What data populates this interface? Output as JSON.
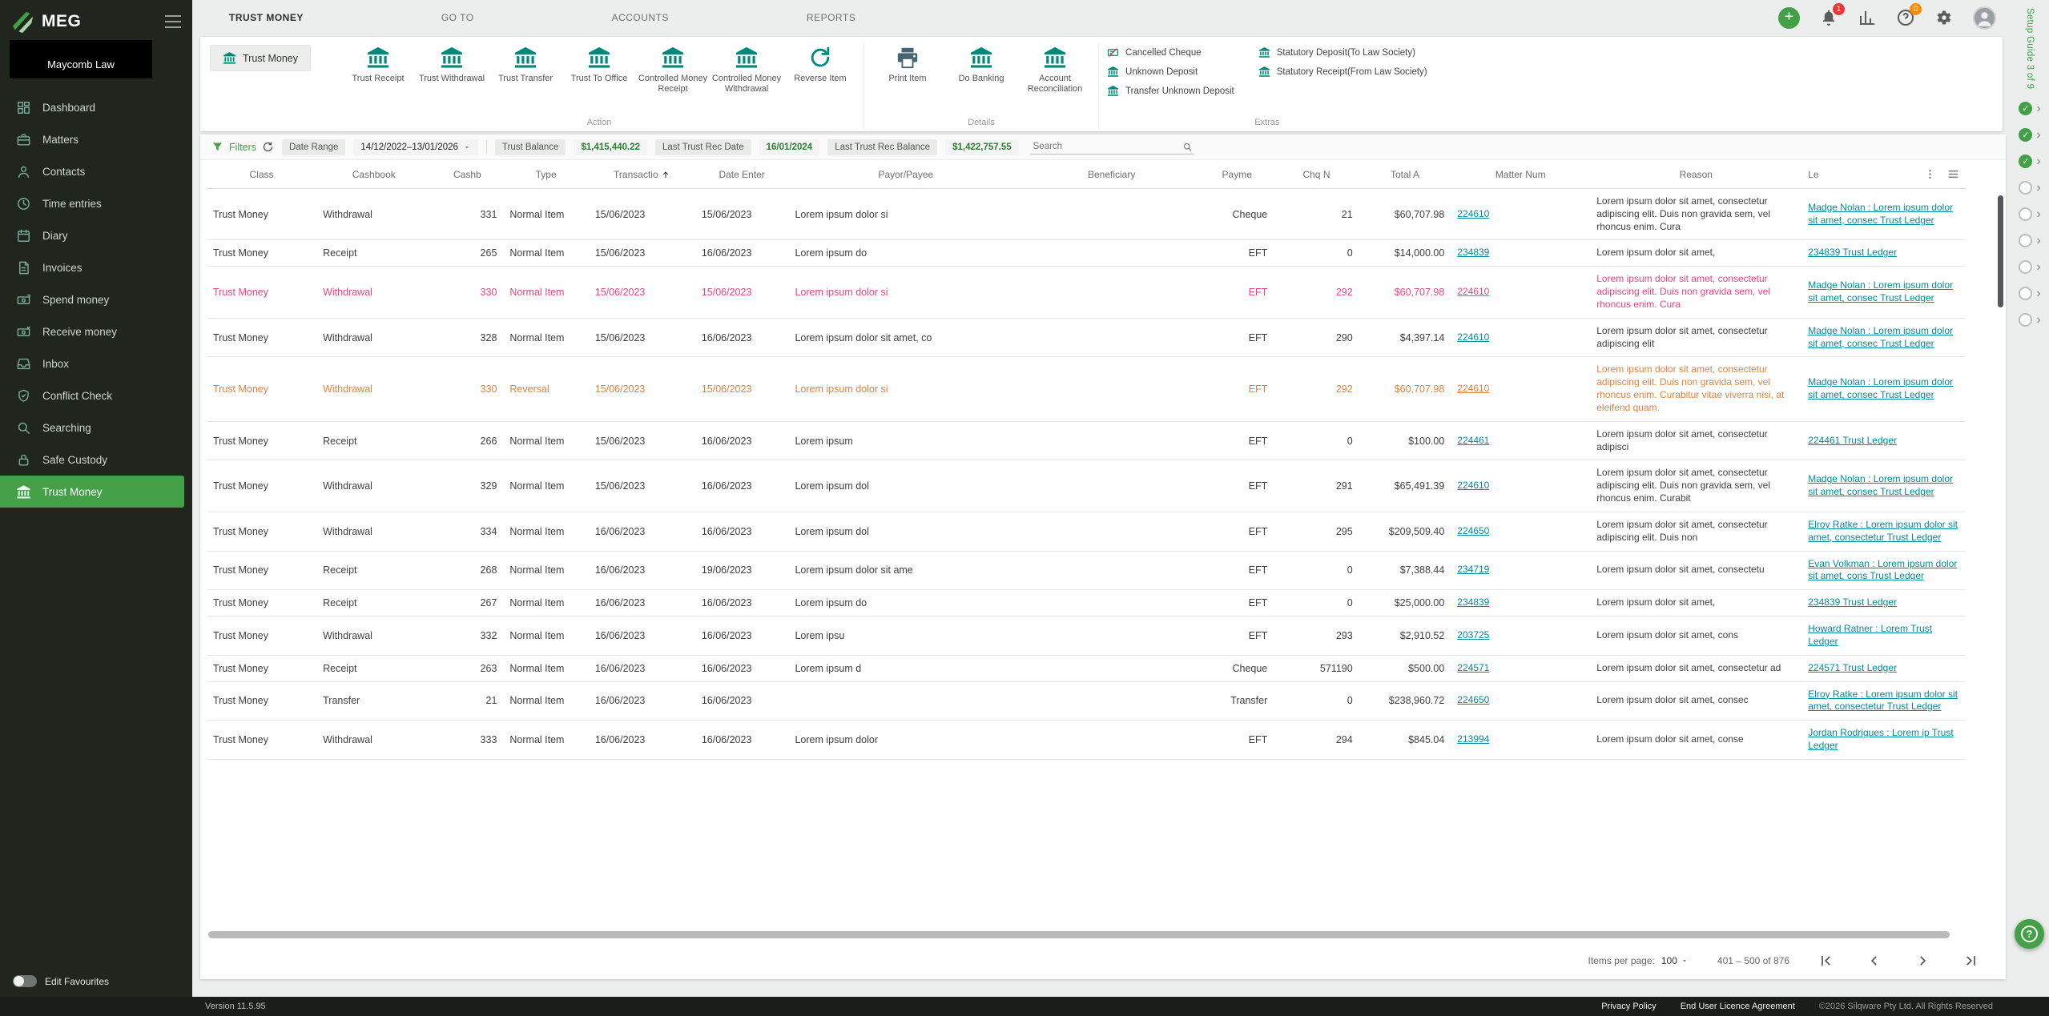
{
  "brand": {
    "logo_text": "MEG",
    "firm_name": "Maycomb Law",
    "version": "Version 11.5.95"
  },
  "topnav": {
    "tabs": [
      {
        "label": "TRUST MONEY",
        "active": true
      },
      {
        "label": "GO TO",
        "active": false
      },
      {
        "label": "ACCOUNTS",
        "active": false
      },
      {
        "label": "REPORTS",
        "active": false
      }
    ],
    "notifications_badge": "1",
    "help_badge": "0"
  },
  "sidebar": {
    "items": [
      {
        "label": "Dashboard",
        "icon": "dashboard-icon",
        "active": false
      },
      {
        "label": "Matters",
        "icon": "briefcase-icon",
        "active": false
      },
      {
        "label": "Contacts",
        "icon": "contacts-icon",
        "active": false
      },
      {
        "label": "Time entries",
        "icon": "clock-icon",
        "active": false
      },
      {
        "label": "Diary",
        "icon": "calendar-icon",
        "active": false
      },
      {
        "label": "Invoices",
        "icon": "invoice-icon",
        "active": false
      },
      {
        "label": "Spend money",
        "icon": "spend-money-icon",
        "active": false
      },
      {
        "label": "Receive money",
        "icon": "receive-money-icon",
        "active": false
      },
      {
        "label": "Inbox",
        "icon": "inbox-icon",
        "active": false
      },
      {
        "label": "Conflict Check",
        "icon": "shield-icon",
        "active": false
      },
      {
        "label": "Searching",
        "icon": "search-icon",
        "active": false
      },
      {
        "label": "Safe Custody",
        "icon": "lock-icon",
        "active": false
      },
      {
        "label": "Trust Money",
        "icon": "bank-icon",
        "active": true
      }
    ],
    "edit_favourites_label": "Edit Favourites"
  },
  "toolbar": {
    "tab_label": "Trust Money",
    "groups": [
      {
        "label": "Action",
        "items": [
          {
            "label": "Trust Receipt",
            "icon": "bank-icon"
          },
          {
            "label": "Trust Withdrawal",
            "icon": "bank-icon"
          },
          {
            "label": "Trust Transfer",
            "icon": "bank-icon"
          },
          {
            "label": "Trust To Office",
            "icon": "bank-icon"
          },
          {
            "label": "Controlled Money Receipt",
            "icon": "bank-icon"
          },
          {
            "label": "Controlled Money Withdrawal",
            "icon": "bank-icon"
          },
          {
            "label": "Reverse Item",
            "icon": "reverse-icon"
          }
        ]
      },
      {
        "label": "Details",
        "items": [
          {
            "label": "Print Item",
            "icon": "printer-icon"
          },
          {
            "label": "Do Banking",
            "icon": "bank-icon"
          },
          {
            "label": "Account Reconciliation",
            "icon": "bank-icon"
          }
        ]
      }
    ],
    "extras": {
      "label": "Extras",
      "left": [
        {
          "label": "Cancelled Cheque",
          "icon": "cancelled-cheque-icon"
        },
        {
          "label": "Unknown Deposit",
          "icon": "bank-small-icon"
        },
        {
          "label": "Transfer Unknown Deposit",
          "icon": "bank-small-icon"
        }
      ],
      "right": [
        {
          "label": "Statutory Deposit(To Law Society)",
          "icon": "bank-small-icon"
        },
        {
          "label": "Statutory Receipt(From Law Society)",
          "icon": "bank-small-icon"
        }
      ]
    }
  },
  "filters": {
    "label": "Filters",
    "date_range_label": "Date Range",
    "date_range_value": "14/12/2022–13/01/2026",
    "trust_balance_label": "Trust Balance",
    "trust_balance_value": "$1,415,440.22",
    "last_rec_date_label": "Last Trust Rec Date",
    "last_rec_date_value": "16/01/2024",
    "last_rec_balance_label": "Last Trust Rec Balance",
    "last_rec_balance_value": "$1,422,757.55",
    "search_placeholder": "Search"
  },
  "table": {
    "columns": [
      {
        "label": "Class"
      },
      {
        "label": "Cashbook"
      },
      {
        "label": "Cashb",
        "align": "right"
      },
      {
        "label": "Type"
      },
      {
        "label": "Transactio",
        "sort": "asc"
      },
      {
        "label": "Date Enter"
      },
      {
        "label": "Payor/Payee"
      },
      {
        "label": "Beneficiary"
      },
      {
        "label": "Payme",
        "align": "right"
      },
      {
        "label": "Chq N",
        "align": "right"
      },
      {
        "label": "Total A",
        "align": "right"
      },
      {
        "label": "Matter Num"
      },
      {
        "label": "Reason"
      },
      {
        "label": "Le"
      }
    ],
    "rows": [
      {
        "class": "Trust Money",
        "cashbook": "Withdrawal",
        "number": "331",
        "type": "Normal Item",
        "trans_date": "15/06/2023",
        "entered_date": "15/06/2023",
        "payor": "Lorem ipsum dolor si",
        "beneficiary": "",
        "payment": "Cheque",
        "chq": "21",
        "total": "$60,707.98",
        "matter": "224610",
        "reason": "Lorem ipsum dolor sit amet, consectetur adipiscing elit. Duis non gravida sem, vel rhoncus enim. Cura",
        "ledger": "Madge Nolan : Lorem ipsum dolor sit amet, consec Trust Ledger",
        "state": "normal"
      },
      {
        "class": "Trust Money",
        "cashbook": "Receipt",
        "number": "265",
        "type": "Normal Item",
        "trans_date": "15/06/2023",
        "entered_date": "16/06/2023",
        "payor": "Lorem ipsum do",
        "beneficiary": "",
        "payment": "EFT",
        "chq": "0",
        "total": "$14,000.00",
        "matter": "234839",
        "reason": "Lorem ipsum dolor sit amet,",
        "ledger": "234839 Trust Ledger",
        "state": "normal"
      },
      {
        "class": "Trust Money",
        "cashbook": "Withdrawal",
        "number": "330",
        "type": "Normal Item",
        "trans_date": "15/06/2023",
        "entered_date": "15/06/2023",
        "payor": "Lorem ipsum dolor si",
        "beneficiary": "",
        "payment": "EFT",
        "chq": "292",
        "total": "$60,707.98",
        "matter": "224610",
        "reason": "Lorem ipsum dolor sit amet, consectetur adipiscing elit. Duis non gravida sem, vel rhoncus enim. Cura",
        "ledger": "Madge Nolan : Lorem ipsum dolor sit amet, consec Trust Ledger",
        "state": "pink"
      },
      {
        "class": "Trust Money",
        "cashbook": "Withdrawal",
        "number": "328",
        "type": "Normal Item",
        "trans_date": "15/06/2023",
        "entered_date": "16/06/2023",
        "payor": "Lorem ipsum dolor sit amet, co",
        "beneficiary": "",
        "payment": "EFT",
        "chq": "290",
        "total": "$4,397.14",
        "matter": "224610",
        "reason": "Lorem ipsum dolor sit amet, consectetur adipiscing elit",
        "ledger": "Madge Nolan : Lorem ipsum dolor sit amet, consec Trust Ledger",
        "state": "normal"
      },
      {
        "class": "Trust Money",
        "cashbook": "Withdrawal",
        "number": "330",
        "type": "Reversal",
        "trans_date": "15/06/2023",
        "entered_date": "15/06/2023",
        "payor": "Lorem ipsum dolor si",
        "beneficiary": "",
        "payment": "EFT",
        "chq": "292",
        "total": "$60,707.98",
        "matter": "224610",
        "reason": "Lorem ipsum dolor sit amet, consectetur adipiscing elit. Duis non gravida sem, vel rhoncus enim. Curabitur vitae viverra nisi, at eleifend quam.",
        "ledger": "Madge Nolan : Lorem ipsum dolor sit amet, consec Trust Ledger",
        "state": "orange"
      },
      {
        "class": "Trust Money",
        "cashbook": "Receipt",
        "number": "266",
        "type": "Normal Item",
        "trans_date": "15/06/2023",
        "entered_date": "16/06/2023",
        "payor": "Lorem ipsum",
        "beneficiary": "",
        "payment": "EFT",
        "chq": "0",
        "total": "$100.00",
        "matter": "224461",
        "reason": "Lorem ipsum dolor sit amet, consectetur adipisci",
        "ledger": "224461 Trust Ledger",
        "state": "normal"
      },
      {
        "class": "Trust Money",
        "cashbook": "Withdrawal",
        "number": "329",
        "type": "Normal Item",
        "trans_date": "15/06/2023",
        "entered_date": "16/06/2023",
        "payor": "Lorem ipsum dol",
        "beneficiary": "",
        "payment": "EFT",
        "chq": "291",
        "total": "$65,491.39",
        "matter": "224610",
        "reason": "Lorem ipsum dolor sit amet, consectetur adipiscing elit. Duis non gravida sem, vel rhoncus enim. Curabit",
        "ledger": "Madge Nolan : Lorem ipsum dolor sit amet, consec Trust Ledger",
        "state": "normal"
      },
      {
        "class": "Trust Money",
        "cashbook": "Withdrawal",
        "number": "334",
        "type": "Normal Item",
        "trans_date": "16/06/2023",
        "entered_date": "16/06/2023",
        "payor": "Lorem ipsum dol",
        "beneficiary": "",
        "payment": "EFT",
        "chq": "295",
        "total": "$209,509.40",
        "matter": "224650",
        "reason": "Lorem ipsum dolor sit amet, consectetur adipiscing elit. Duis non",
        "ledger": "Elroy Ratke : Lorem ipsum dolor sit amet, consectetur Trust Ledger",
        "state": "normal"
      },
      {
        "class": "Trust Money",
        "cashbook": "Receipt",
        "number": "268",
        "type": "Normal Item",
        "trans_date": "16/06/2023",
        "entered_date": "19/06/2023",
        "payor": "Lorem ipsum dolor sit ame",
        "beneficiary": "",
        "payment": "EFT",
        "chq": "0",
        "total": "$7,388.44",
        "matter": "234719",
        "reason": "Lorem ipsum dolor sit amet, consectetu",
        "ledger": "Evan Volkman : Lorem ipsum dolor sit amet, cons Trust Ledger",
        "state": "normal"
      },
      {
        "class": "Trust Money",
        "cashbook": "Receipt",
        "number": "267",
        "type": "Normal Item",
        "trans_date": "16/06/2023",
        "entered_date": "16/06/2023",
        "payor": "Lorem ipsum do",
        "beneficiary": "",
        "payment": "EFT",
        "chq": "0",
        "total": "$25,000.00",
        "matter": "234839",
        "reason": "Lorem ipsum dolor sit amet,",
        "ledger": "234839 Trust Ledger",
        "state": "normal"
      },
      {
        "class": "Trust Money",
        "cashbook": "Withdrawal",
        "number": "332",
        "type": "Normal Item",
        "trans_date": "16/06/2023",
        "entered_date": "16/06/2023",
        "payor": "Lorem ipsu",
        "beneficiary": "",
        "payment": "EFT",
        "chq": "293",
        "total": "$2,910.52",
        "matter": "203725",
        "reason": "Lorem ipsum dolor sit amet, cons",
        "ledger": "Howard Ratner : Lorem Trust Ledger",
        "state": "normal"
      },
      {
        "class": "Trust Money",
        "cashbook": "Receipt",
        "number": "263",
        "type": "Normal Item",
        "trans_date": "16/06/2023",
        "entered_date": "16/06/2023",
        "payor": "Lorem ipsum d",
        "beneficiary": "",
        "payment": "Cheque",
        "chq": "571190",
        "total": "$500.00",
        "matter": "224571",
        "reason": "Lorem ipsum dolor sit amet, consectetur ad",
        "ledger": "224571 Trust Ledger",
        "state": "normal"
      },
      {
        "class": "Trust Money",
        "cashbook": "Transfer",
        "number": "21",
        "type": "Normal Item",
        "trans_date": "16/06/2023",
        "entered_date": "16/06/2023",
        "payor": "",
        "beneficiary": "",
        "payment": "Transfer",
        "chq": "0",
        "total": "$238,960.72",
        "matter": "224650",
        "reason": "Lorem ipsum dolor sit amet, consec",
        "ledger": "Elroy Ratke : Lorem ipsum dolor sit amet, consectetur Trust Ledger",
        "state": "normal"
      },
      {
        "class": "Trust Money",
        "cashbook": "Withdrawal",
        "number": "333",
        "type": "Normal Item",
        "trans_date": "16/06/2023",
        "entered_date": "16/06/2023",
        "payor": "Lorem ipsum dolor",
        "beneficiary": "",
        "payment": "EFT",
        "chq": "294",
        "total": "$845.04",
        "matter": "213994",
        "reason": "Lorem ipsum dolor sit amet, conse",
        "ledger": "Jordan Rodrigues : Lorem ip Trust Ledger",
        "state": "normal"
      }
    ]
  },
  "pagination": {
    "items_per_page_label": "Items per page:",
    "items_per_page": "100",
    "range_label": "401 – 500 of 876"
  },
  "footer": {
    "privacy": "Privacy Policy",
    "eula": "End User Licence Agreement",
    "copyright": "©2026 Silqware Pty Ltd. All Rights Reserved"
  },
  "setup_guide": {
    "label": "Setup Guide 3 of 9",
    "total_steps": 9,
    "completed_steps": 3
  }
}
